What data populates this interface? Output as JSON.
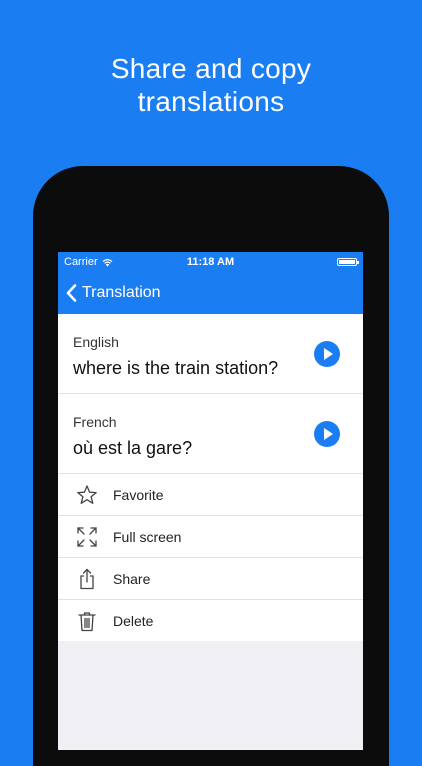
{
  "promo": {
    "line1": "Share and copy",
    "line2": "translations"
  },
  "status": {
    "carrier": "Carrier",
    "time": "11:18 AM"
  },
  "nav": {
    "back_label": "Translation"
  },
  "translation": {
    "source_lang": "English",
    "source_text": "where is the train station?",
    "target_lang": "French",
    "target_text": "où est la gare?"
  },
  "actions": [
    {
      "label": "Favorite",
      "icon": "star-icon"
    },
    {
      "label": "Full screen",
      "icon": "expand-icon"
    },
    {
      "label": "Share",
      "icon": "share-icon"
    },
    {
      "label": "Delete",
      "icon": "trash-icon"
    }
  ],
  "colors": {
    "accent": "#1a7ef2",
    "background": "#efeff4"
  }
}
